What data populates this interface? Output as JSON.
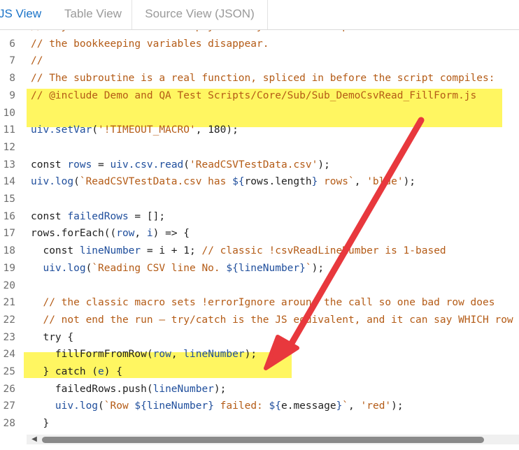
{
  "tabs": [
    {
      "label": "JS View",
      "active": true
    },
    {
      "label": "Table View",
      "active": false
    },
    {
      "label": "Source View (JSON)",
      "active": false
    }
  ],
  "lines": [
    {
      "n": "",
      "tokens": [
        [
          "com",
          "//   y                     p y       y             p"
        ]
      ]
    },
    {
      "n": "6",
      "tokens": [
        [
          "com",
          "// the bookkeeping variables disappear."
        ]
      ]
    },
    {
      "n": "7",
      "tokens": [
        [
          "com",
          "//"
        ]
      ]
    },
    {
      "n": "8",
      "tokens": [
        [
          "com",
          "// The subroutine is a real function, spliced in before the script compiles:"
        ]
      ]
    },
    {
      "n": "9",
      "tokens": [
        [
          "com",
          "// @include Demo and QA Test Scripts/Core/Sub/Sub_DemoCsvRead_FillForm.js"
        ]
      ]
    },
    {
      "n": "10",
      "tokens": []
    },
    {
      "n": "11",
      "tokens": [
        [
          "fn",
          "uiv.setVar"
        ],
        [
          "kw",
          "("
        ],
        [
          "str",
          "'!TIMEOUT_MACRO'"
        ],
        [
          "kw",
          ", 180);"
        ]
      ]
    },
    {
      "n": "12",
      "tokens": []
    },
    {
      "n": "13",
      "tokens": [
        [
          "kw",
          "const "
        ],
        [
          "var",
          "rows"
        ],
        [
          "kw",
          " = "
        ],
        [
          "fn",
          "uiv.csv.read"
        ],
        [
          "kw",
          "("
        ],
        [
          "str",
          "'ReadCSVTestData.csv'"
        ],
        [
          "kw",
          ");"
        ]
      ]
    },
    {
      "n": "14",
      "tokens": [
        [
          "fn",
          "uiv.log"
        ],
        [
          "kw",
          "("
        ],
        [
          "str",
          "`ReadCSVTestData.csv has "
        ],
        [
          "tpl",
          "${"
        ],
        [
          "kw",
          "rows.length"
        ],
        [
          "tpl",
          "}"
        ],
        [
          "str",
          " rows`"
        ],
        [
          "kw",
          ", "
        ],
        [
          "str",
          "'blue'"
        ],
        [
          "kw",
          ");"
        ]
      ]
    },
    {
      "n": "15",
      "tokens": []
    },
    {
      "n": "16",
      "tokens": [
        [
          "kw",
          "const "
        ],
        [
          "var",
          "failedRows"
        ],
        [
          "kw",
          " = [];"
        ]
      ]
    },
    {
      "n": "17",
      "tokens": [
        [
          "kw",
          "rows.forEach(("
        ],
        [
          "var",
          "row"
        ],
        [
          "kw",
          ", "
        ],
        [
          "var",
          "i"
        ],
        [
          "kw",
          ") => {"
        ]
      ]
    },
    {
      "n": "18",
      "tokens": [
        [
          "kw",
          "  const "
        ],
        [
          "var",
          "lineNumber"
        ],
        [
          "kw",
          " = i + 1; "
        ],
        [
          "com",
          "// classic !csvReadLineNumber is 1-based"
        ]
      ]
    },
    {
      "n": "19",
      "tokens": [
        [
          "fn",
          "  uiv.log"
        ],
        [
          "kw",
          "("
        ],
        [
          "str",
          "`Reading CSV line No. "
        ],
        [
          "tpl",
          "${"
        ],
        [
          "var",
          "lineNumber"
        ],
        [
          "tpl",
          "}"
        ],
        [
          "str",
          "`"
        ],
        [
          "kw",
          ");"
        ]
      ]
    },
    {
      "n": "20",
      "tokens": []
    },
    {
      "n": "21",
      "tokens": [
        [
          "com",
          "  // the classic macro sets !errorIgnore around the call so one bad row does"
        ]
      ]
    },
    {
      "n": "22",
      "tokens": [
        [
          "com",
          "  // not end the run — try/catch is the JS equivalent, and it can say WHICH row"
        ]
      ]
    },
    {
      "n": "23",
      "tokens": [
        [
          "kw",
          "  try {"
        ]
      ]
    },
    {
      "n": "24",
      "tokens": [
        [
          "kw",
          "    fillFormFromRow("
        ],
        [
          "var",
          "row"
        ],
        [
          "kw",
          ", "
        ],
        [
          "var",
          "lineNumber"
        ],
        [
          "kw",
          ");"
        ]
      ]
    },
    {
      "n": "25",
      "tokens": [
        [
          "kw",
          "  } catch ("
        ],
        [
          "var",
          "e"
        ],
        [
          "kw",
          ") {"
        ]
      ]
    },
    {
      "n": "26",
      "tokens": [
        [
          "kw",
          "    failedRows.push("
        ],
        [
          "var",
          "lineNumber"
        ],
        [
          "kw",
          ");"
        ]
      ]
    },
    {
      "n": "27",
      "tokens": [
        [
          "fn",
          "    uiv.log"
        ],
        [
          "kw",
          "("
        ],
        [
          "str",
          "`Row "
        ],
        [
          "tpl",
          "${"
        ],
        [
          "var",
          "lineNumber"
        ],
        [
          "tpl",
          "}"
        ],
        [
          "str",
          " failed: "
        ],
        [
          "tpl",
          "${"
        ],
        [
          "kw",
          "e.message"
        ],
        [
          "tpl",
          "}"
        ],
        [
          "str",
          "`"
        ],
        [
          "kw",
          ", "
        ],
        [
          "str",
          "'red'"
        ],
        [
          "kw",
          ");"
        ]
      ]
    },
    {
      "n": "28",
      "tokens": [
        [
          "kw",
          "  }"
        ]
      ]
    }
  ],
  "colors": {
    "highlight": "#fff100",
    "arrow": "#e8383d",
    "active_tab": "#1a73c8"
  },
  "scrollbar": {
    "left_arrow_icon": "chevron-left-icon"
  }
}
